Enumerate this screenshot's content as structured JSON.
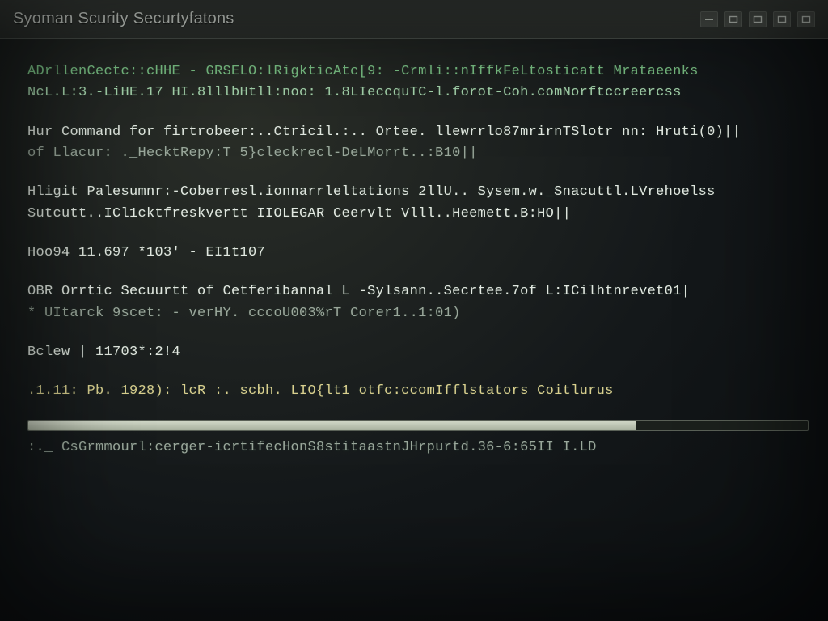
{
  "window": {
    "title": "Syoman Scurity Securtyfatons"
  },
  "colors": {
    "bg": "#14181a",
    "titlebar": "#2c302d",
    "text_green": "#7fc98a",
    "text_white": "#e2e8e1",
    "progress_fill": "#cfd6c6"
  },
  "progress": {
    "percent": 78
  },
  "terminal": {
    "blocks": [
      {
        "lines": [
          {
            "cls": "green",
            "text": "ADrllenCectc::cHHE - GRSELO:lRigkticAtc[9: -Crmli::nIffkFeLtosticatt Mrataeenks"
          },
          {
            "cls": "palegrn",
            "text": "NcL.L:3.-LiHE.17 HI.8lllbHtll:noo: 1.8LIeccquTC-l.forot-Coh.comNorftccreercss"
          }
        ]
      },
      {
        "lines": [
          {
            "cls": "white",
            "text": "Hur Command for firtrobeer:..Ctricil.:.. Ortee. llewrrlo87mrirnTSlotr nn: Hruti(0)||"
          },
          {
            "cls": "dim",
            "text": "of Llacur: ._HecktRepy:T  5}cleckrecl-DeLMorrt..:B10||"
          }
        ]
      },
      {
        "lines": [
          {
            "cls": "white",
            "text": "Hligit Palesumnr:-Coberresl.ionnarrleltations 2llU.. Sysem.w._Snacuttl.LVrehoelss"
          },
          {
            "cls": "white",
            "text": "Sutcutt..ICl1cktfreskvertt IIOLEGAR Ceervlt Vlll..Heemett.B:HO||"
          }
        ]
      },
      {
        "lines": [
          {
            "cls": "white",
            "text": "Hoo94 11.697 *103' - EI1t107"
          }
        ]
      },
      {
        "lines": [
          {
            "cls": "white",
            "text": "OBR Orrtic Secuurtt of Cetferibannal L -Sylsann..Secrtee.7of L:ICilhtnrevet01|"
          },
          {
            "cls": "dim",
            "text": "* UItarck 9scet: - verHY. cccoU003%rT Corer1..1:01)"
          }
        ]
      },
      {
        "lines": [
          {
            "cls": "white",
            "text": "Bclew | 11703*:2!4"
          }
        ]
      },
      {
        "lines": [
          {
            "cls": "yellow",
            "text": ".1.11:  Pb.  1928):  lcR  :.  scbh.   LIO{lt1 otfc:ccomIfflstators Coitlurus"
          }
        ]
      }
    ],
    "footer": ":._ CsGrmmourl:cerger-icrtifecHonS8stitaastnJHrpurtd.36-6:65II I.LD"
  }
}
